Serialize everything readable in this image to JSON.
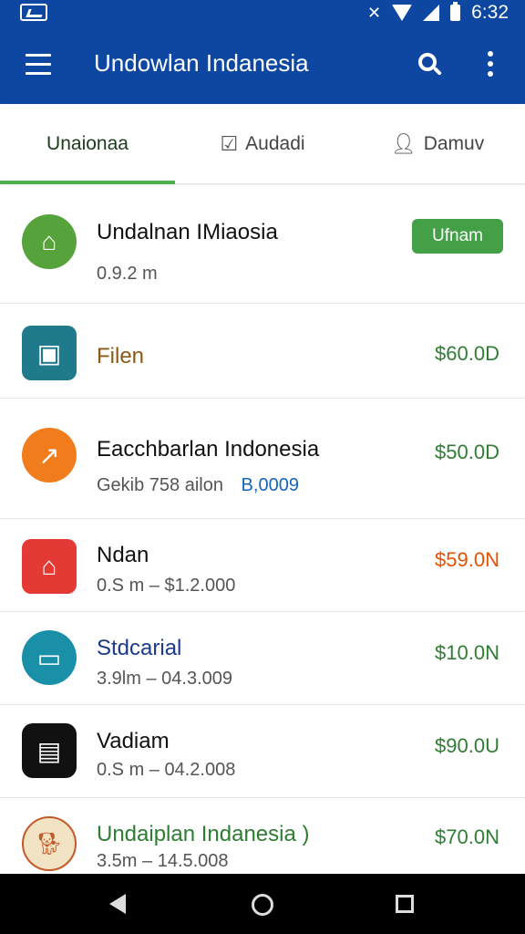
{
  "status_bar": {
    "time": "6:32",
    "icons": [
      "image-icon",
      "vibrate-icon",
      "wifi-icon",
      "signal-icon",
      "battery-icon"
    ]
  },
  "app_bar": {
    "title": "Undowlan Indanesia",
    "icons": [
      "menu-icon",
      "search-icon",
      "more-vert-icon"
    ]
  },
  "tabs": [
    {
      "label": "Unaionaa",
      "icon": "",
      "selected": true
    },
    {
      "label": "Audadi",
      "icon": "check-box-icon",
      "selected": false
    },
    {
      "label": "Damuv",
      "icon": "person-icon",
      "selected": false
    }
  ],
  "colors": {
    "primary": "#0d47a1",
    "accent_green": "#4caf50",
    "price_green": "#2e7d32",
    "price_orange": "#e65100"
  },
  "items": [
    {
      "name": "Undalnan IMiaosia",
      "sub": "0.9.2 m",
      "price": "",
      "badge": "Ufnam",
      "icon": "home-icon",
      "icon_color": "#55a33a"
    },
    {
      "name": "Filen",
      "sub": "",
      "price": "$60.0D",
      "badge": "",
      "icon": "image-icon",
      "icon_color": "#1f7a8c"
    },
    {
      "name": "Eacchbarlan Indonesia",
      "sub": "Gekib 758 ailon",
      "sub_highlight": "B,0009",
      "price": "$50.0D",
      "badge": "",
      "icon": "chart-icon",
      "icon_color": "#f07c1c"
    },
    {
      "name": "Ndan",
      "sub": "0.S m – $1.2.000",
      "price": "$59.0N",
      "badge": "",
      "icon": "house-icon",
      "icon_color": "#e53935"
    },
    {
      "name": "Stdcarial",
      "sub": "3.9lm – 04.3.009",
      "price": "$10.0N",
      "badge": "",
      "icon": "monitor-icon",
      "icon_color": "#1a8fa8"
    },
    {
      "name": "Vadiam",
      "sub": "0.S m – 04.2.008",
      "price": "$90.0U",
      "badge": "",
      "icon": "device-icon",
      "icon_color": "#111111"
    },
    {
      "name": "Undaiplan Indanesia )",
      "sub": "3.5m – 14.5.008",
      "price": "$70.0N",
      "badge": "",
      "icon": "dog-logo-icon",
      "icon_color": "#c45a2a"
    }
  ],
  "nav_bar": {
    "icons": [
      "back-icon",
      "home-circle-icon",
      "recent-apps-icon"
    ]
  }
}
